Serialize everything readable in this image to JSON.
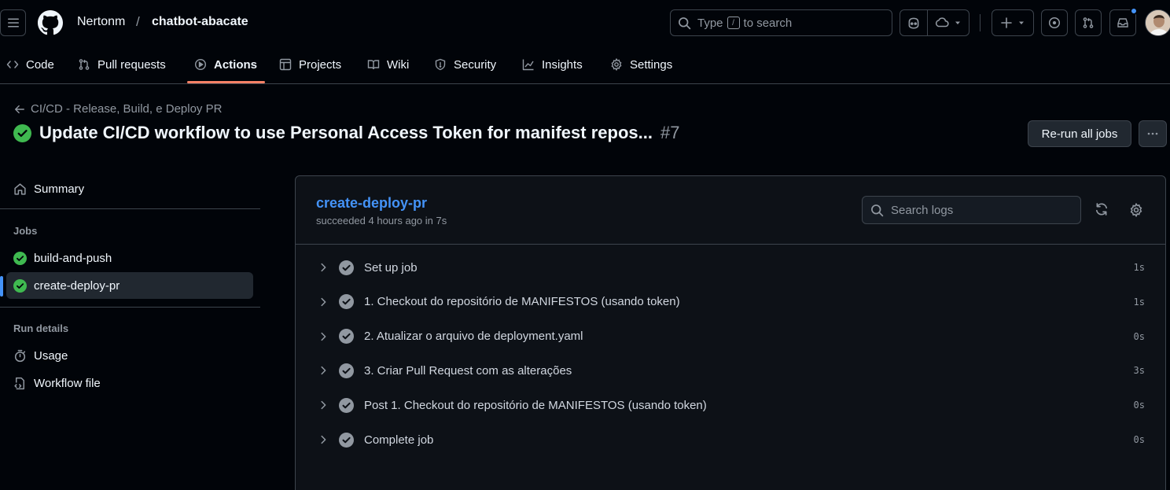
{
  "header": {
    "owner": "Nertonm",
    "separator": "/",
    "repo": "chatbot-abacate",
    "search": {
      "prefix": "Type",
      "key": "/",
      "suffix": "to search"
    }
  },
  "tabs": [
    {
      "label": "Code",
      "icon": "code-icon"
    },
    {
      "label": "Pull requests",
      "icon": "git-pull-request-icon"
    },
    {
      "label": "Actions",
      "icon": "play-icon",
      "active": true
    },
    {
      "label": "Projects",
      "icon": "table-icon"
    },
    {
      "label": "Wiki",
      "icon": "book-icon"
    },
    {
      "label": "Security",
      "icon": "shield-icon"
    },
    {
      "label": "Insights",
      "icon": "graph-icon"
    },
    {
      "label": "Settings",
      "icon": "gear-icon"
    }
  ],
  "run": {
    "workflow_name": "CI/CD - Release, Build, e Deploy PR",
    "title": "Update CI/CD workflow to use Personal Access Token for manifest repos...",
    "number": "#7",
    "rerun_label": "Re-run all jobs"
  },
  "sidebar": {
    "summary": "Summary",
    "jobs_heading": "Jobs",
    "jobs": [
      {
        "label": "build-and-push",
        "status": "success"
      },
      {
        "label": "create-deploy-pr",
        "status": "success",
        "selected": true
      }
    ],
    "run_details_heading": "Run details",
    "details": [
      {
        "label": "Usage",
        "icon": "stopwatch-icon"
      },
      {
        "label": "Workflow file",
        "icon": "file-code-icon"
      }
    ]
  },
  "job": {
    "name": "create-deploy-pr",
    "status_line": "succeeded 4 hours ago in 7s",
    "search_placeholder": "Search logs",
    "steps": [
      {
        "label": "Set up job",
        "duration": "1s"
      },
      {
        "label": "1. Checkout do repositório de MANIFESTOS (usando token)",
        "duration": "1s"
      },
      {
        "label": "2. Atualizar o arquivo de deployment.yaml",
        "duration": "0s"
      },
      {
        "label": "3. Criar Pull Request com as alterações",
        "duration": "3s"
      },
      {
        "label": "Post 1. Checkout do repositório de MANIFESTOS (usando token)",
        "duration": "0s"
      },
      {
        "label": "Complete job",
        "duration": "0s"
      }
    ]
  },
  "colors": {
    "background": "#010409",
    "success": "#3fb950",
    "link": "#4493f8",
    "tab_underline": "#f78166",
    "notification_dot": "#4493f8"
  }
}
